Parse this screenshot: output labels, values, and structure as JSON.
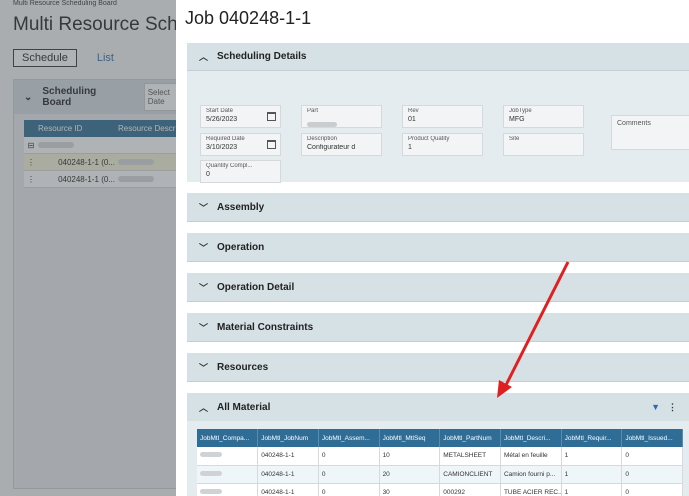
{
  "app": {
    "breadcrumb": "Multi Resource Scheduling Board",
    "title": "Multi Resource Sched",
    "tabs": [
      "Schedule",
      "List"
    ],
    "board_title": "Scheduling Board",
    "select_date": "Select Date",
    "grid_headers": [
      "Resource ID",
      "Resource Descr"
    ],
    "grid_rows": [
      "040248-1-1 (0...",
      "040248-1-1 (0..."
    ]
  },
  "panel": {
    "title": "Job 040248-1-1",
    "scheduling": {
      "header": "Scheduling Details",
      "start_date_label": "Start Date",
      "start_date": "5/26/2023",
      "required_date_label": "Required Date",
      "required_date": "3/10/2023",
      "quantity_label": "Quantity Compl...",
      "quantity": "0",
      "part_label": "Part",
      "description_label": "Description",
      "description": "Configurateur d",
      "rev_label": "Rev",
      "rev": "01",
      "product_qty_label": "Product Quatity",
      "product_qty": "1",
      "jobtype_label": "JobType",
      "jobtype": "MFG",
      "site_label": "Site",
      "comments_label": "Comments"
    },
    "sections": [
      "Assembly",
      "Operation",
      "Operation Detail",
      "Material Constraints",
      "Resources"
    ],
    "all_material": {
      "header": "All Material",
      "columns": [
        "JobMtl_Compa...",
        "JobMtl_JobNum",
        "JobMtl_Assem...",
        "JobMtl_MtlSeq",
        "JobMtl_PartNum",
        "JobMtl_Descri...",
        "JobMtl_Requir...",
        "JobMtl_Issued..."
      ],
      "rows": [
        [
          "",
          "040248-1-1",
          "0",
          "10",
          "METALSHEET",
          "Métal en feuille",
          "1",
          "0"
        ],
        [
          "",
          "040248-1-1",
          "0",
          "20",
          "CAMIONCLIENT",
          "Camion fourni p...",
          "1",
          "0"
        ],
        [
          "",
          "040248-1-1",
          "0",
          "30",
          "000292",
          "TUBE ACIER REC...",
          "1",
          "0"
        ]
      ]
    }
  },
  "colors": {
    "accent": "#2f6d96",
    "arrow": "#e02020"
  }
}
